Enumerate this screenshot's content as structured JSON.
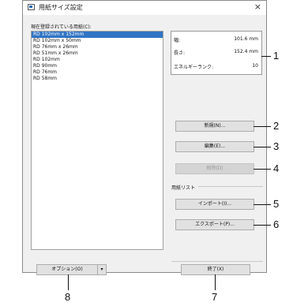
{
  "window": {
    "title": "用紙サイズ設定",
    "close_glyph": "×"
  },
  "list": {
    "label": "現在登録されている用紙(C):",
    "items": [
      "RD 102mm x 152mm",
      "RD 102mm x 50mm",
      "RD 76mm x 26mm",
      "RD 51mm x 26mm",
      "RD 102mm",
      "RD 90mm",
      "RD 76mm",
      "RD 58mm"
    ],
    "selected_index": 0
  },
  "info": {
    "width_label": "幅:",
    "width_value": "101.6 mm",
    "length_label": "長さ:",
    "length_value": "152.4 mm",
    "energy_label": "エネルギーランク:",
    "energy_value": "10"
  },
  "buttons": {
    "new": "新規(N)...",
    "edit": "編集(E)...",
    "delete": "削除(D)"
  },
  "paper_list_group": {
    "label": "用紙リスト",
    "import": "インポート(I)...",
    "export": "エクスポート(P)..."
  },
  "footer": {
    "options": "オプション(O)",
    "options_arrow": "▾",
    "close": "終了(X)"
  },
  "callouts": [
    "1",
    "2",
    "3",
    "4",
    "5",
    "6",
    "7",
    "8"
  ]
}
